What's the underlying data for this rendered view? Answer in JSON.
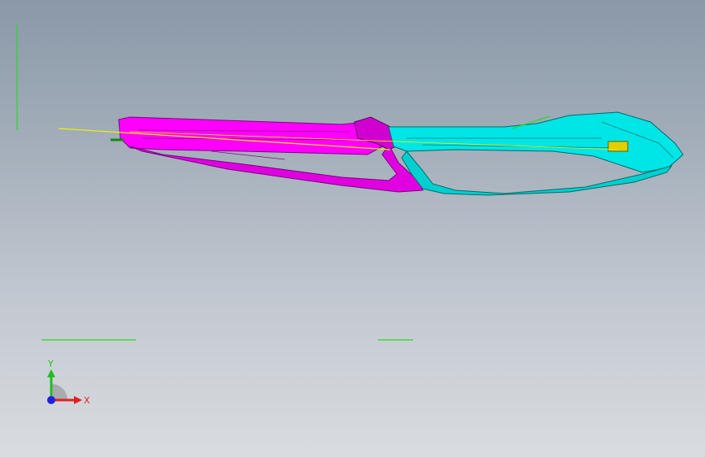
{
  "viewport": {
    "background_top": "#8a98a8",
    "background_bottom": "#d9dce0"
  },
  "model": {
    "part_rear_color": "#ff00ff",
    "part_front_color": "#00e5e5",
    "edge_color_rear": "#7a0080",
    "edge_color_front": "#006a6a",
    "sketch_line_color": "#f0f000",
    "axis_line_color": "#22dd22"
  },
  "triad": {
    "y_label": "Y",
    "x_label": "X",
    "y_color": "#1fbf1f",
    "x_color": "#e02020",
    "z_color": "#2020e0"
  }
}
